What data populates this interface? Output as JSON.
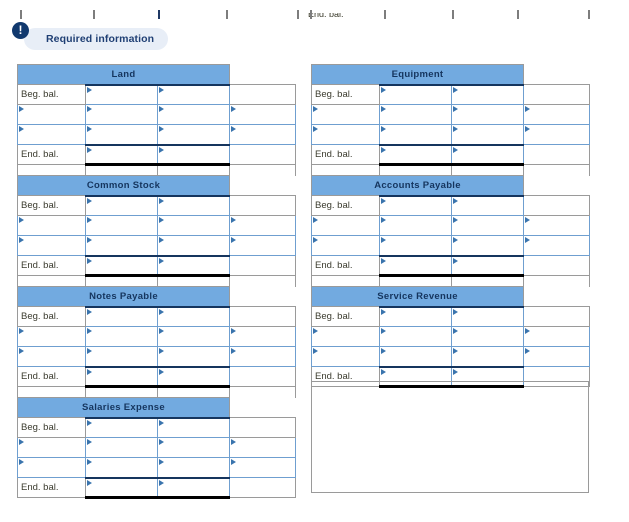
{
  "badge": {
    "icon": "exclamation-icon",
    "glyph": "!",
    "label": "Required information"
  },
  "top_remnant": {
    "cut_label": "End. bal."
  },
  "row_labels": {
    "beg": "Beg. bal.",
    "end": "End. bal.",
    "blank": ""
  },
  "colors": {
    "header_blue": "#72aae0",
    "badge_circle": "#11396e",
    "badge_pill": "#e8eef7",
    "badge_text": "#1f3f74",
    "cell_border_blue": "#6f9fd0",
    "grid_border": "#9a9a9a",
    "rule_black": "#000000"
  },
  "accounts": [
    {
      "title": "Land",
      "column": "left",
      "rows": [
        {
          "label": "Beg. bal.",
          "debit": "",
          "credit": "",
          "extra": ""
        },
        {
          "label": "",
          "debit": "",
          "credit": "",
          "extra": ""
        },
        {
          "label": "",
          "debit": "",
          "credit": "",
          "extra": ""
        },
        {
          "label": "End. bal.",
          "debit": "",
          "credit": "",
          "extra": ""
        }
      ]
    },
    {
      "title": "Equipment",
      "column": "right",
      "rows": [
        {
          "label": "Beg. bal.",
          "debit": "",
          "credit": "",
          "extra": ""
        },
        {
          "label": "",
          "debit": "",
          "credit": "",
          "extra": ""
        },
        {
          "label": "",
          "debit": "",
          "credit": "",
          "extra": ""
        },
        {
          "label": "End. bal.",
          "debit": "",
          "credit": "",
          "extra": ""
        }
      ]
    },
    {
      "title": "Common Stock",
      "column": "left",
      "rows": [
        {
          "label": "Beg. bal.",
          "debit": "",
          "credit": "",
          "extra": ""
        },
        {
          "label": "",
          "debit": "",
          "credit": "",
          "extra": ""
        },
        {
          "label": "",
          "debit": "",
          "credit": "",
          "extra": ""
        },
        {
          "label": "End. bal.",
          "debit": "",
          "credit": "",
          "extra": ""
        }
      ]
    },
    {
      "title": "Accounts Payable",
      "column": "right",
      "rows": [
        {
          "label": "Beg. bal.",
          "debit": "",
          "credit": "",
          "extra": ""
        },
        {
          "label": "",
          "debit": "",
          "credit": "",
          "extra": ""
        },
        {
          "label": "",
          "debit": "",
          "credit": "",
          "extra": ""
        },
        {
          "label": "End. bal.",
          "debit": "",
          "credit": "",
          "extra": ""
        }
      ]
    },
    {
      "title": "Notes Payable",
      "column": "left",
      "rows": [
        {
          "label": "Beg. bal.",
          "debit": "",
          "credit": "",
          "extra": ""
        },
        {
          "label": "",
          "debit": "",
          "credit": "",
          "extra": ""
        },
        {
          "label": "",
          "debit": "",
          "credit": "",
          "extra": ""
        },
        {
          "label": "End. bal.",
          "debit": "",
          "credit": "",
          "extra": ""
        }
      ]
    },
    {
      "title": "Service Revenue",
      "column": "right",
      "rows": [
        {
          "label": "Beg. bal.",
          "debit": "",
          "credit": "",
          "extra": ""
        },
        {
          "label": "",
          "debit": "",
          "credit": "",
          "extra": ""
        },
        {
          "label": "",
          "debit": "",
          "credit": "",
          "extra": ""
        },
        {
          "label": "End. bal.",
          "debit": "",
          "credit": "",
          "extra": ""
        }
      ]
    },
    {
      "title": "Salaries Expense",
      "column": "left",
      "rows": [
        {
          "label": "Beg. bal.",
          "debit": "",
          "credit": "",
          "extra": ""
        },
        {
          "label": "",
          "debit": "",
          "credit": "",
          "extra": ""
        },
        {
          "label": "",
          "debit": "",
          "credit": "",
          "extra": ""
        },
        {
          "label": "End. bal.",
          "debit": "",
          "credit": "",
          "extra": ""
        }
      ]
    }
  ]
}
